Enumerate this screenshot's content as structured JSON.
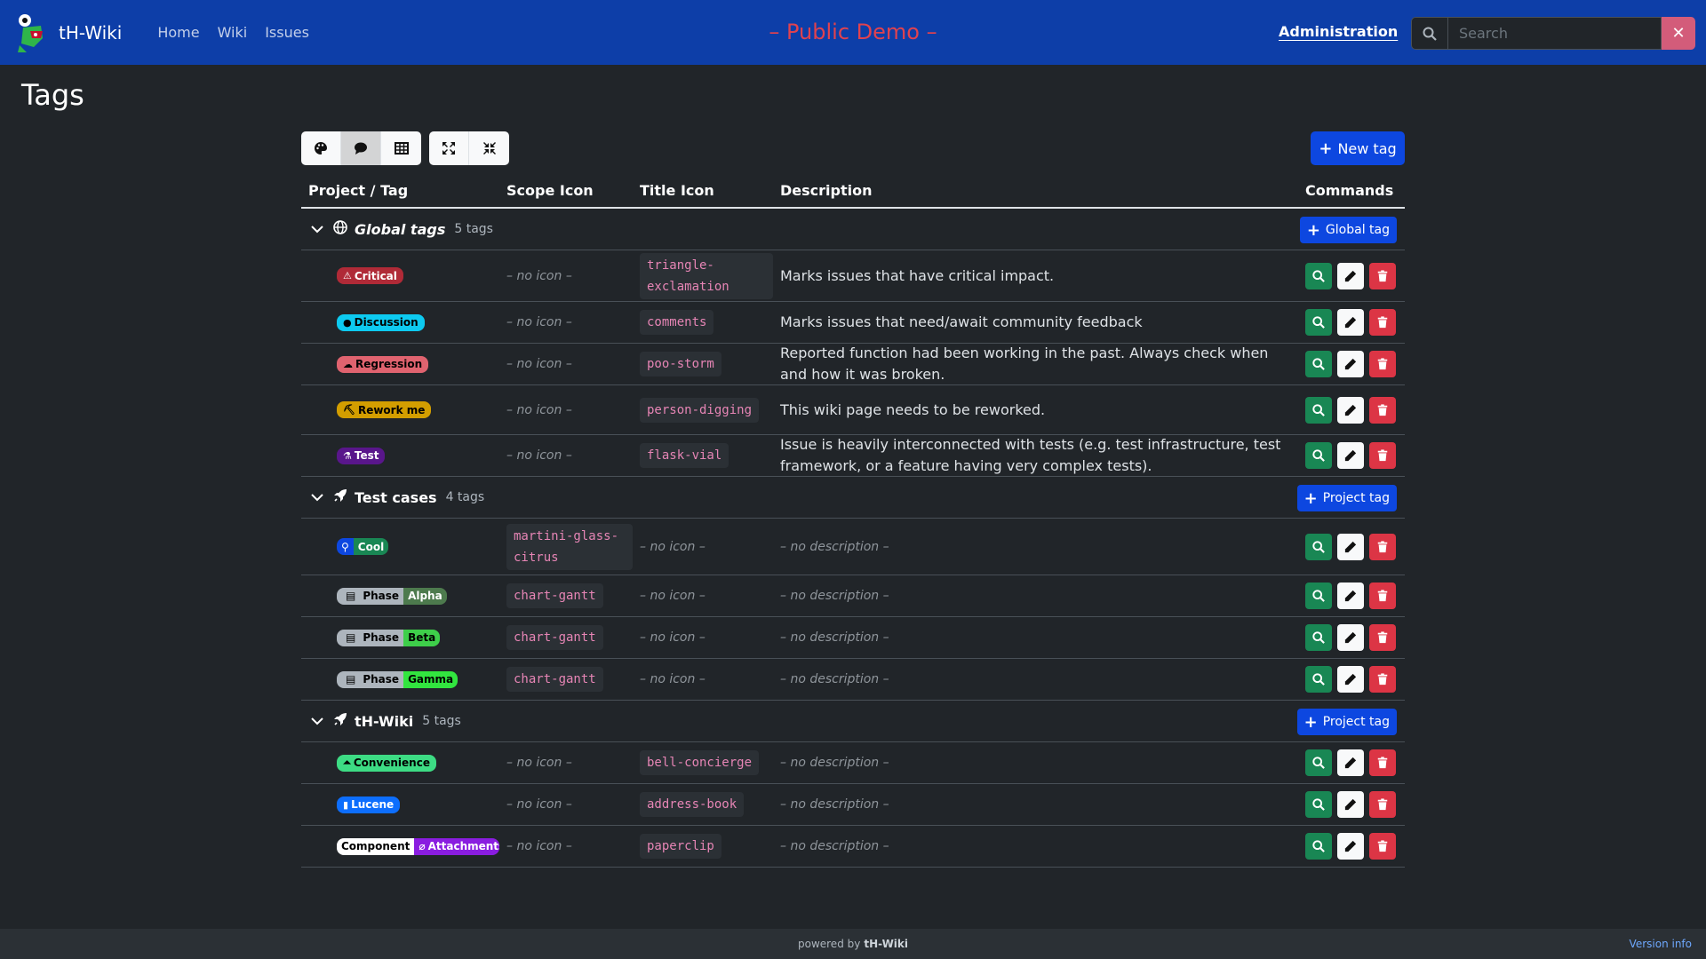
{
  "nav": {
    "brand": "tH-Wiki",
    "links": [
      "Home",
      "Wiki",
      "Issues"
    ],
    "demo_title": "– Public Demo –",
    "admin": "Administration",
    "search_placeholder": "Search"
  },
  "page": {
    "title": "Tags",
    "new_tag": "New tag"
  },
  "table": {
    "headers": [
      "Project / Tag",
      "Scope Icon",
      "Title Icon",
      "Description",
      "Commands"
    ]
  },
  "groups": [
    {
      "name": "Global tags",
      "count": "5 tags",
      "button": "Global tag",
      "rows": [
        {
          "tag": "Critical",
          "color": "#b02a37",
          "text_color": "#ffffff",
          "icon": "warning-icon",
          "scope_icon": "– no icon –",
          "title_icon": "triangle-exclamation",
          "description": "Marks issues that have critical impact."
        },
        {
          "tag": "Discussion",
          "color": "#0dcaf0",
          "text_color": "#000000",
          "icon": "comments-icon",
          "scope_icon": "– no icon –",
          "title_icon": "comments",
          "description": "Marks issues that need/await community feedback"
        },
        {
          "tag": "Regression",
          "color": "#e0636f",
          "text_color": "#000000",
          "icon": "storm-icon",
          "scope_icon": "– no icon –",
          "title_icon": "poo-storm",
          "description": "Reported function had been working in the past. Always check when and how it was broken."
        },
        {
          "tag": "Rework me",
          "color": "#d39e00",
          "text_color": "#000000",
          "icon": "digging-icon",
          "scope_icon": "– no icon –",
          "title_icon": "person-digging",
          "description": "This wiki page needs to be reworked."
        },
        {
          "tag": "Test",
          "color": "#59168b",
          "text_color": "#ffffff",
          "icon": "flask-icon",
          "scope_icon": "– no icon –",
          "title_icon": "flask-vial",
          "description": "Issue is heavily interconnected with tests (e.g. test infrastructure, test framework, or a feature having very complex tests)."
        }
      ]
    },
    {
      "name": "Test cases",
      "count": "4 tags",
      "button": "Project tag",
      "rows": [
        {
          "tag_scope": "",
          "tag": "Cool",
          "scope_color": "#0d47e0",
          "color": "#198754",
          "scope_icon": "martini-glass-citrus",
          "title_icon": "– no icon –",
          "description": "– no description –"
        },
        {
          "tag_scope": "Phase",
          "tag": "Alpha",
          "scope_color": "#adb5bd",
          "color": "#4d7a4d",
          "scope_icon": "chart-gantt",
          "title_icon": "– no icon –",
          "description": "– no description –"
        },
        {
          "tag_scope": "Phase",
          "tag": "Beta",
          "scope_color": "#adb5bd",
          "color": "#3ecf4a",
          "scope_icon": "chart-gantt",
          "title_icon": "– no icon –",
          "description": "– no description –"
        },
        {
          "tag_scope": "Phase",
          "tag": "Gamma",
          "scope_color": "#adb5bd",
          "color": "#32e53f",
          "scope_icon": "chart-gantt",
          "title_icon": "– no icon –",
          "description": "– no description –"
        }
      ]
    },
    {
      "name": "tH-Wiki",
      "count": "5 tags",
      "button": "Project tag",
      "rows": [
        {
          "tag": "Convenience",
          "color": "#3ddc84",
          "text_color": "#000000",
          "icon": "bell-icon",
          "scope_icon": "– no icon –",
          "title_icon": "bell-concierge",
          "description": "– no description –"
        },
        {
          "tag": "Lucene",
          "color": "#0d6efd",
          "text_color": "#ffffff",
          "icon": "address-book-icon",
          "scope_icon": "– no icon –",
          "title_icon": "address-book",
          "description": "– no description –"
        },
        {
          "tag_scope": "Component",
          "tag": "Attachments",
          "scope_color": "#ffffff",
          "color": "#8a1de0",
          "scope_icon": "– no icon –",
          "title_icon": "paperclip",
          "description": "– no description –"
        }
      ]
    }
  ],
  "footer": {
    "powered_by": "powered by",
    "brand": "tH-Wiki",
    "version": "Version info"
  }
}
